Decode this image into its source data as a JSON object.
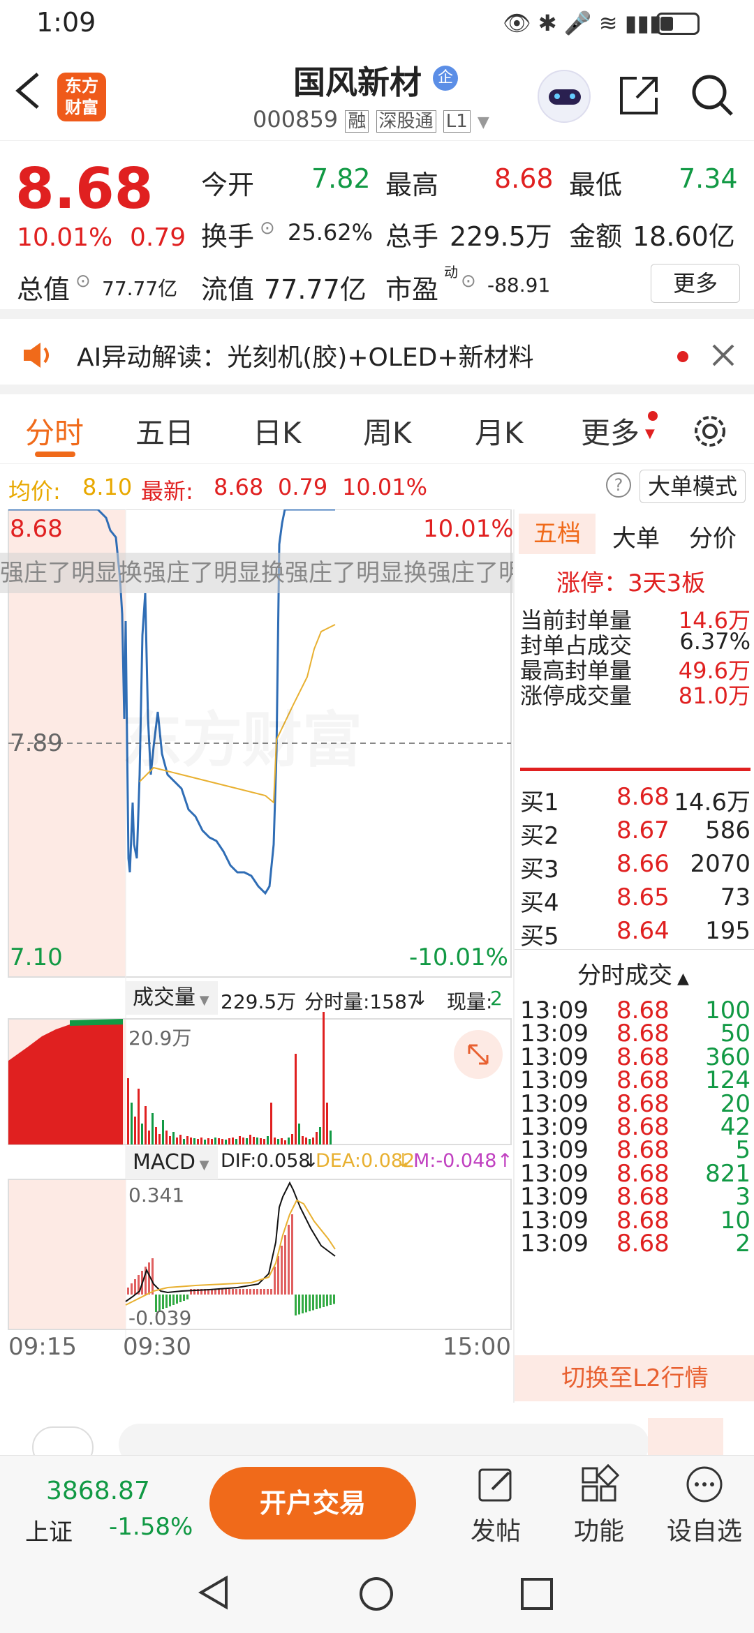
{
  "status": {
    "time": "1:09"
  },
  "header": {
    "title": "国风新材",
    "badge": "企",
    "code": "000859",
    "tags": [
      "融",
      "深股通",
      "L1"
    ],
    "logo_line1": "东方",
    "logo_line2": "财富"
  },
  "quote": {
    "price": "8.68",
    "change_pct": "10.01%",
    "change": "0.79",
    "open_label": "今开",
    "open": "7.82",
    "high_label": "最高",
    "high": "8.68",
    "low_label": "最低",
    "low": "7.34",
    "turnover_label": "换手",
    "turnover": "25.62%",
    "volume_label": "总手",
    "volume": "229.5万",
    "amount_label": "金额",
    "amount": "18.60亿",
    "mcap_label": "总值",
    "mcap": "77.77亿",
    "float_label": "流值",
    "float": "77.77亿",
    "pe_label": "市盈",
    "pe_sup": "动",
    "pe": "-88.91",
    "more": "更多"
  },
  "ai": {
    "text": "AI异动解读：光刻机(胶)+OLED+新材料"
  },
  "tabs": [
    "分时",
    "五日",
    "日K",
    "周K",
    "月K",
    "更多"
  ],
  "infoline": {
    "avg_label": "均价:",
    "avg": "8.10",
    "latest_label": "最新:",
    "latest": "8.68",
    "chg": "0.79",
    "pct": "10.01%",
    "mode": "大单模式"
  },
  "chart": {
    "top_price": "8.68",
    "top_pct": "10.01%",
    "mid_price": "7.89",
    "bot_price": "7.10",
    "bot_pct": "-10.01%",
    "watermark": "东方财富",
    "marquee": "强庄了明显换强庄了明显换强庄了明显换强庄了明显换强庄了明",
    "vol_label": "成交量",
    "vol_total": "229.5万",
    "vol_fen_label": "分时量:1587",
    "vol_now_label": "现量:",
    "vol_now": "2",
    "vol_max": "20.9万",
    "macd_label": "MACD",
    "dif": "DIF:0.058",
    "dea": "DEA:0.082",
    "m": "M:-0.048",
    "macd_top": "0.341",
    "macd_bot": "-0.039",
    "t_start": "09:15",
    "t_mid": "09:30",
    "t_end": "15:00"
  },
  "side": {
    "tabs": [
      "五档",
      "大单",
      "分价"
    ],
    "limit_label": "涨停：3天3板",
    "stats": [
      {
        "label": "当前封单量",
        "value": "14.6万"
      },
      {
        "label": "封单占成交",
        "value": "6.37%"
      },
      {
        "label": "最高封单量",
        "value": "49.6万"
      },
      {
        "label": "涨停成交量",
        "value": "81.0万"
      }
    ],
    "bids": [
      {
        "label": "买1",
        "price": "8.68",
        "vol": "14.6万"
      },
      {
        "label": "买2",
        "price": "8.67",
        "vol": "586"
      },
      {
        "label": "买3",
        "price": "8.66",
        "vol": "2070"
      },
      {
        "label": "买4",
        "price": "8.65",
        "vol": "73"
      },
      {
        "label": "买5",
        "price": "8.64",
        "vol": "195"
      }
    ],
    "trades_title": "分时成交",
    "trades": [
      {
        "t": "13:09",
        "p": "8.68",
        "v": "100"
      },
      {
        "t": "13:09",
        "p": "8.68",
        "v": "50"
      },
      {
        "t": "13:09",
        "p": "8.68",
        "v": "360"
      },
      {
        "t": "13:09",
        "p": "8.68",
        "v": "124"
      },
      {
        "t": "13:09",
        "p": "8.68",
        "v": "20"
      },
      {
        "t": "13:09",
        "p": "8.68",
        "v": "42"
      },
      {
        "t": "13:09",
        "p": "8.68",
        "v": "5"
      },
      {
        "t": "13:09",
        "p": "8.68",
        "v": "821"
      },
      {
        "t": "13:09",
        "p": "8.68",
        "v": "3"
      },
      {
        "t": "13:09",
        "p": "8.68",
        "v": "10"
      },
      {
        "t": "13:09",
        "p": "8.68",
        "v": "2"
      }
    ],
    "switch": "切换至L2行情"
  },
  "bottom": {
    "index_value": "3868.87",
    "index_name": "上证",
    "index_pct": "-1.58%",
    "trade_btn": "开户交易",
    "post": "发帖",
    "func": "功能",
    "watch": "设自选"
  }
}
